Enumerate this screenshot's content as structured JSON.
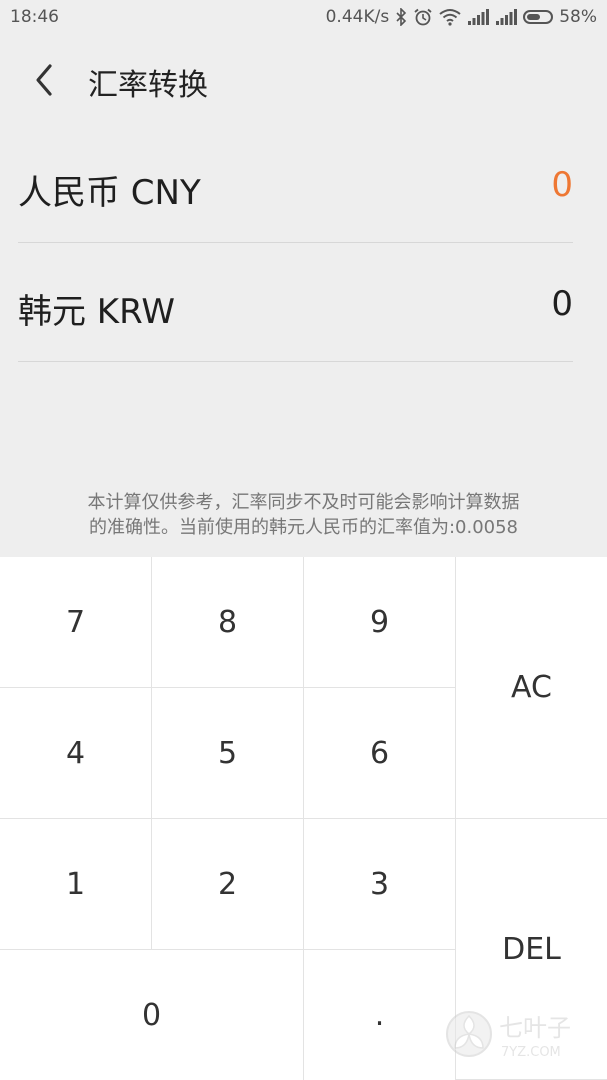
{
  "status_bar": {
    "time": "18:46",
    "network_speed": "0.44K/s",
    "battery": "58%",
    "battery_level": 0.58,
    "icons": [
      "bluetooth-icon",
      "alarm-icon",
      "wifi-icon",
      "signal-icon",
      "signal-icon",
      "battery-icon"
    ]
  },
  "header": {
    "title": "汇率转换",
    "back_icon": "chevron-left-icon"
  },
  "currencies": [
    {
      "label": "人民币 CNY",
      "value": "0",
      "active": true
    },
    {
      "label": "韩元 KRW",
      "value": "0",
      "active": false
    }
  ],
  "note": {
    "line1": "本计算仅供参考，汇率同步不及时可能会影响计算数据",
    "line2": "的准确性。当前使用的韩元人民币的汇率值为:0.0058"
  },
  "keypad": {
    "k7": "7",
    "k8": "8",
    "k9": "9",
    "ac": "AC",
    "k4": "4",
    "k5": "5",
    "k6": "6",
    "k1": "1",
    "k2": "2",
    "k3": "3",
    "del": "DEL",
    "k0": "0",
    "dot": "."
  },
  "colors": {
    "accent": "#ee7733",
    "background": "#eeeeee",
    "keypad_bg": "#ffffff"
  },
  "watermark": {
    "name": "七叶子",
    "site": "7YZ.COM"
  }
}
